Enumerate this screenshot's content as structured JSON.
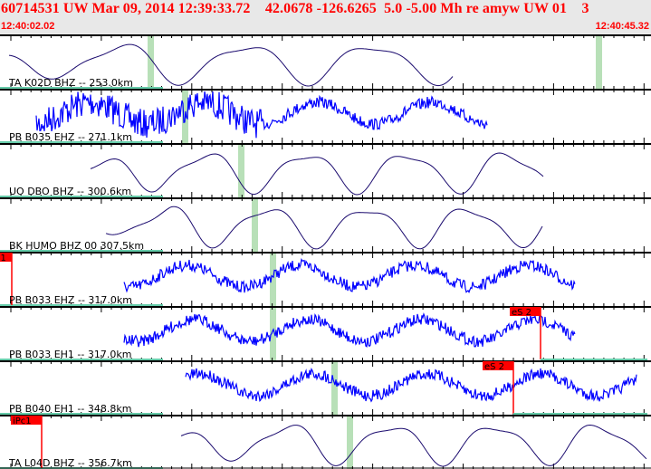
{
  "header": {
    "title": "60714531 UW Mar 09, 2014 12:39:33.72    42.0678 -126.6265  5.0 -5.00 Mh re amyw UW 01    3",
    "time_start": "12:40:02.02",
    "time_end": "12:40:45.32"
  },
  "colors": {
    "header_text": "#ff0000",
    "trace_broadband": "#1a0a6e",
    "trace_short_period": "#0000ff",
    "pick": "#ff0000",
    "phase_window": "#b8e0b8",
    "baseline": "#66ccaa"
  },
  "channels": [
    {
      "label": "TA K02D BHZ -- 253.0km",
      "type": "smooth",
      "start": 10,
      "end": 500,
      "windows": [
        166,
        661
      ],
      "picks": []
    },
    {
      "label": "PB B035 EHZ -- 271.1km",
      "type": "noisy",
      "start": 40,
      "end": 538,
      "windows": [
        204
      ],
      "picks": []
    },
    {
      "label": "UO DBO BHZ -- 300.6km",
      "type": "smooth",
      "start": 100,
      "end": 600,
      "windows": [
        266
      ],
      "picks": []
    },
    {
      "label": "BK HUMO BHZ 00 307.5km",
      "type": "smooth",
      "start": 117,
      "end": 600,
      "windows": [
        281
      ],
      "picks": []
    },
    {
      "label": "PB B033 EHZ -- 317.0km",
      "type": "noisy",
      "start": 137,
      "end": 635,
      "windows": [
        301
      ],
      "picks": [
        {
          "label": "c1",
          "at": 13
        }
      ]
    },
    {
      "label": "PB B033 EH1 -- 317.0km",
      "type": "noisy",
      "start": 137,
      "end": 635,
      "windows": [
        301
      ],
      "picks": [
        {
          "label": "eS 2",
          "at": 597
        }
      ]
    },
    {
      "label": "PB B040 EH1 -- 348.8km",
      "type": "noisy",
      "start": 205,
      "end": 703,
      "windows": [
        369
      ],
      "picks": [
        {
          "label": "eS 2",
          "at": 567
        }
      ]
    },
    {
      "label": "TA L04D BHZ -- 356.7km",
      "type": "smooth",
      "start": 200,
      "end": 715,
      "windows": [
        386
      ],
      "picks": [
        {
          "label": "iPc1",
          "at": 46
        }
      ]
    }
  ]
}
